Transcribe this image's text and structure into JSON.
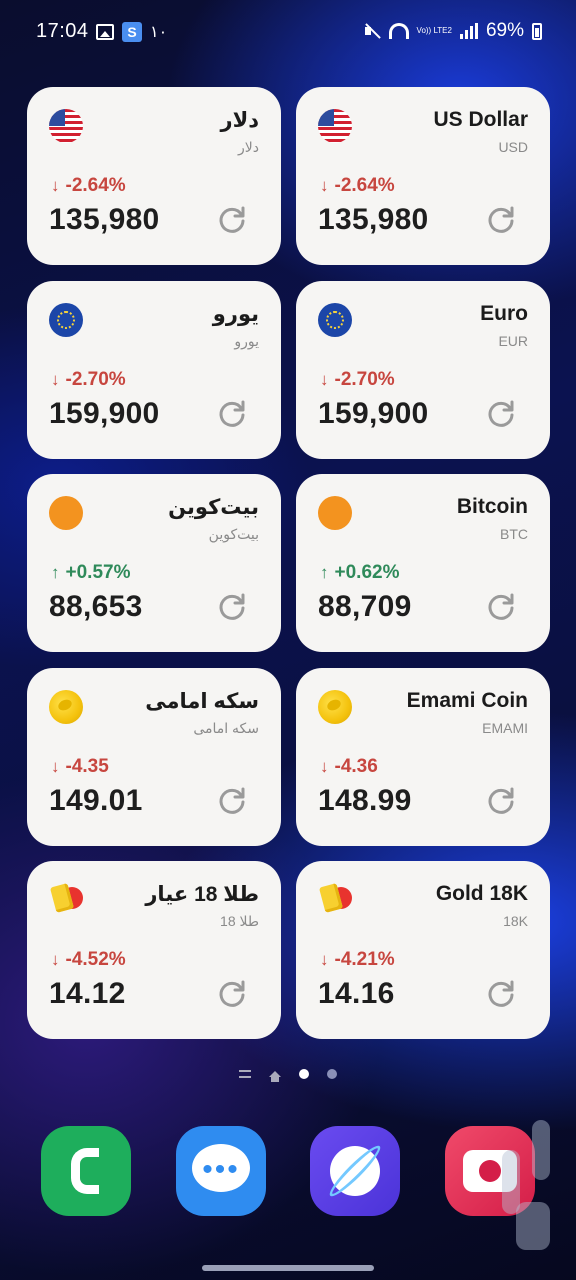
{
  "status_bar": {
    "time": "17:04",
    "app_icon_label": "S",
    "notif_count": "۱۰",
    "network_label": "Vo)) LTE2",
    "battery": "69%"
  },
  "widgets": [
    {
      "flag": "us-flag-icon",
      "name": "دلار",
      "code": "دلار",
      "direction": "down",
      "arrow": "↓",
      "change": "-2.64%",
      "price": "135,980"
    },
    {
      "flag": "us-flag-icon",
      "name": "US Dollar",
      "code": "USD",
      "direction": "down",
      "arrow": "↓",
      "change": "-2.64%",
      "price": "135,980"
    },
    {
      "flag": "eu-flag-icon",
      "name": "یورو",
      "code": "یورو",
      "direction": "down",
      "arrow": "↓",
      "change": "-2.70%",
      "price": "159,900"
    },
    {
      "flag": "eu-flag-icon",
      "name": "Euro",
      "code": "EUR",
      "direction": "down",
      "arrow": "↓",
      "change": "-2.70%",
      "price": "159,900"
    },
    {
      "flag": "bitcoin-icon",
      "name": "بیت‌کوین",
      "code": "بیت‌کوین",
      "direction": "up",
      "arrow": "↑",
      "change": "+0.57%",
      "price": "88,653"
    },
    {
      "flag": "bitcoin-icon",
      "name": "Bitcoin",
      "code": "BTC",
      "direction": "up",
      "arrow": "↑",
      "change": "+0.62%",
      "price": "88,709"
    },
    {
      "flag": "gold-coin-icon",
      "name": "سکه امامی",
      "code": "سکه امامی",
      "direction": "down",
      "arrow": "↓",
      "change": "-4.35",
      "price": "149.01"
    },
    {
      "flag": "gold-coin-icon",
      "name": "Emami Coin",
      "code": "EMAMI",
      "direction": "down",
      "arrow": "↓",
      "change": "-4.36",
      "price": "148.99"
    },
    {
      "flag": "gold-bar-icon",
      "name": "طلا 18 عیار",
      "code": "طلا 18",
      "direction": "down",
      "arrow": "↓",
      "change": "-4.52%",
      "price": "14.12"
    },
    {
      "flag": "gold-bar-icon",
      "name": "Gold 18K",
      "code": "18K",
      "direction": "down",
      "arrow": "↓",
      "change": "-4.21%",
      "price": "14.16"
    }
  ],
  "pager": {
    "active_index": 1
  },
  "dock": [
    "phone-app-icon",
    "messages-app-icon",
    "internet-browser-icon",
    "camera-app-icon"
  ]
}
